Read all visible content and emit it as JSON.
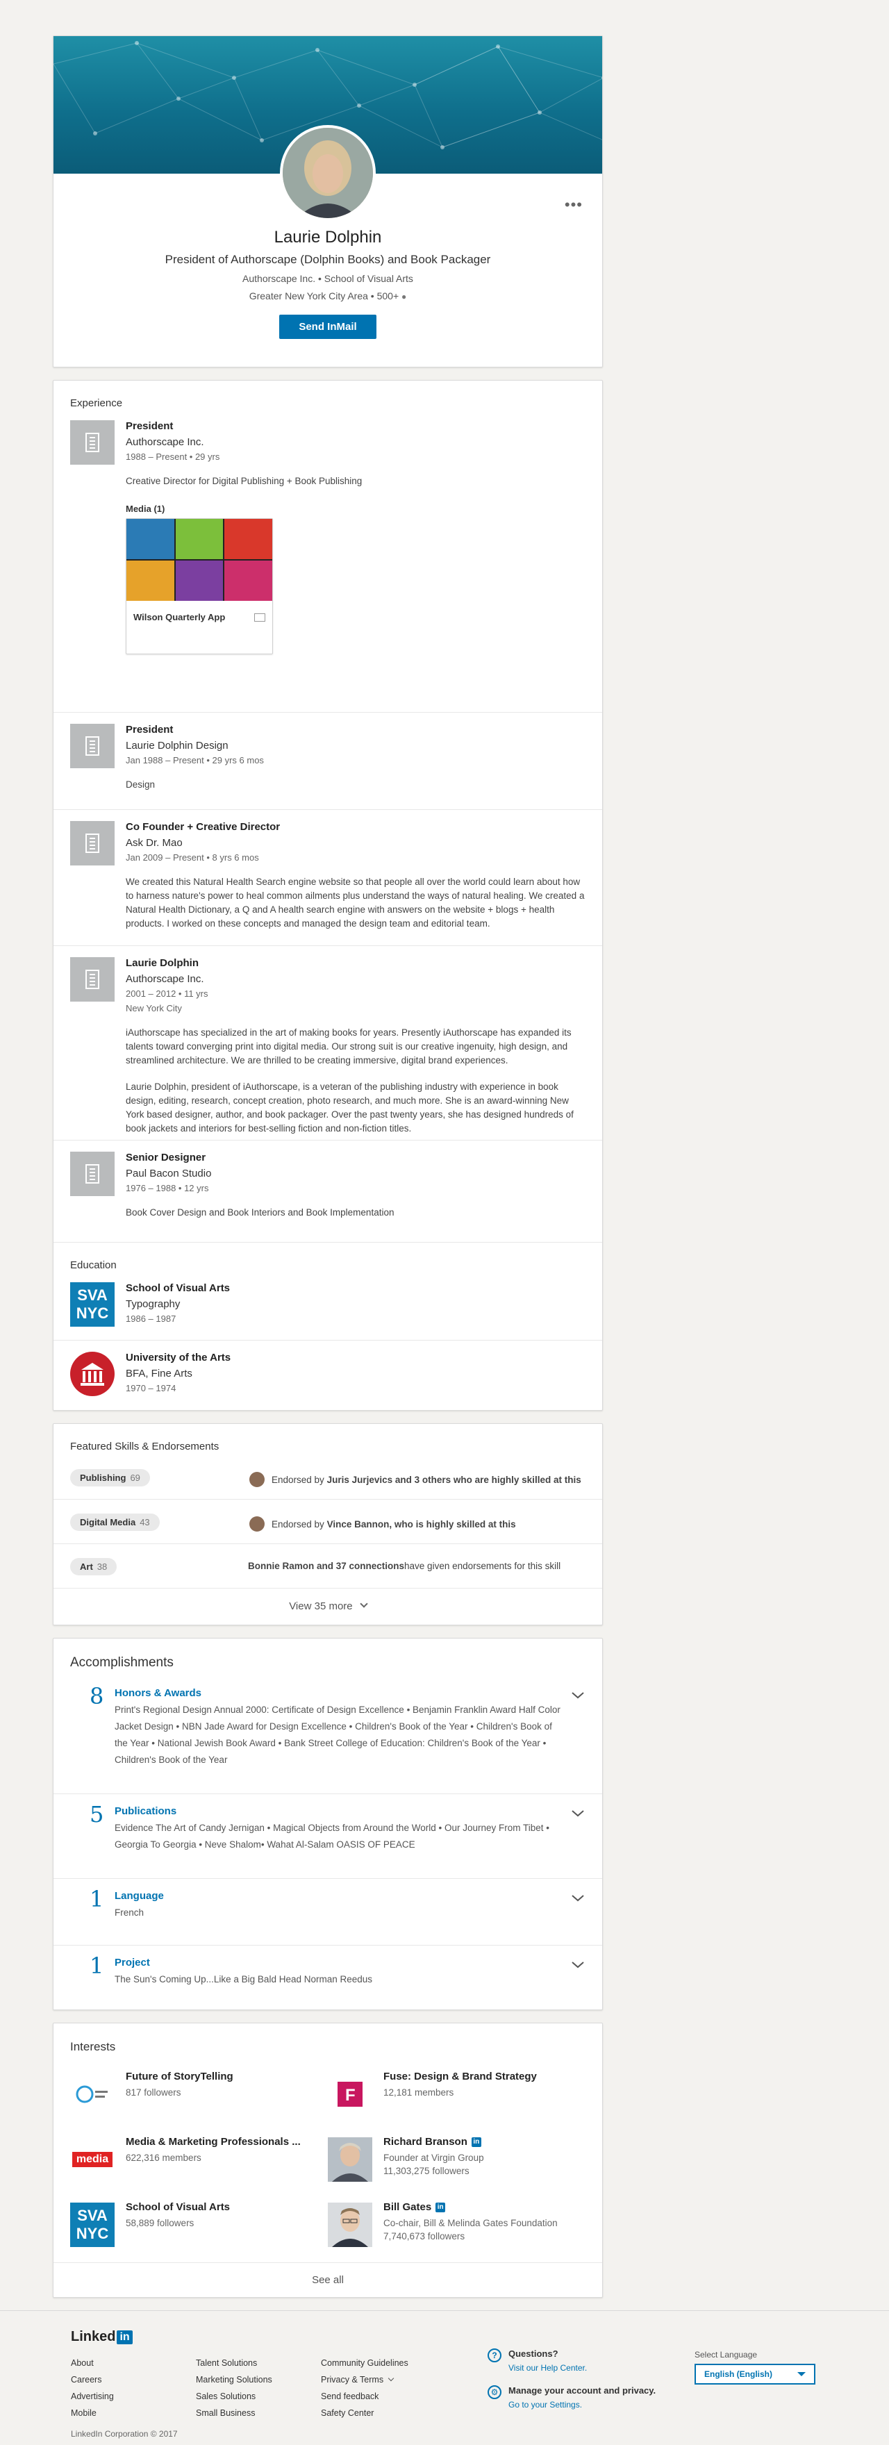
{
  "profile": {
    "name": "Laurie Dolphin",
    "headline": "President of Authorscape (Dolphin Books) and Book Packager",
    "company_line": "Authorscape Inc. • School of Visual Arts",
    "location_line": "Greater New York City Area • 500+",
    "send_inmail": "Send InMail",
    "more_menu": "•••"
  },
  "experience": {
    "title": "Experience",
    "items": [
      {
        "title": "President",
        "company": "Authorscape Inc.",
        "dates": "1988 – Present  • 29 yrs",
        "location": "",
        "desc": "Creative Director for Digital Publishing + Book Publishing",
        "media_label": "Media (1)",
        "media_caption": "Wilson Quarterly App"
      },
      {
        "title": "President",
        "company": "Laurie Dolphin Design",
        "dates": "Jan 1988 – Present  • 29 yrs 6 mos",
        "location": "",
        "desc": "Design"
      },
      {
        "title": "Co Founder + Creative Director",
        "company": "Ask Dr. Mao",
        "dates": "Jan 2009 – Present  • 8 yrs 6 mos",
        "location": "",
        "desc": "We created this Natural Health Search engine website so that people all over the world could learn about how to harness nature's power to heal common ailments plus understand the ways of natural healing. We created a Natural Health Dictionary, a Q and A health search engine with answers on the website + blogs + health products. I worked on these concepts and managed the design team and editorial team."
      },
      {
        "title": "Laurie Dolphin",
        "company": "Authorscape Inc.",
        "dates": "2001 – 2012  • 11 yrs",
        "location": "New York City",
        "desc": "iAuthorscape has specialized in the art of making books for years. Presently iAuthorscape has expanded its talents toward converging print into digital media. Our strong suit is our creative ingenuity, high design, and streamlined architecture. We are thrilled to be creating immersive, digital brand experiences.",
        "desc2": "Laurie Dolphin, president of iAuthorscape, is a veteran of the publishing industry with experience in book design, editing, research, concept creation, photo research, and much more. She is an award-winning New York based designer, author, and book packager. Over the past twenty years, she has designed hundreds of book jackets and interiors for best-selling fiction and non-fiction titles."
      },
      {
        "title": "Senior Designer",
        "company": "Paul Bacon Studio",
        "dates": "1976 – 1988  • 12 yrs",
        "location": "",
        "desc": "Book Cover Design and Book Interiors and Book Implementation"
      }
    ]
  },
  "education": {
    "title": "Education",
    "items": [
      {
        "school": "School of Visual Arts",
        "degree": "Typography",
        "dates": "1986 – 1987",
        "logo_text_1": "SVA",
        "logo_text_2": "NYC"
      },
      {
        "school": "University of the Arts",
        "degree": "BFA, Fine Arts",
        "dates": "1970 – 1974"
      }
    ]
  },
  "skills": {
    "title": "Featured Skills & Endorsements",
    "items": [
      {
        "name": "Publishing",
        "count": "69",
        "endorse_pre": "Endorsed by ",
        "endorse_bold": "Juris Jurjevics and 3 others who are highly skilled at this",
        "endorse_post": ""
      },
      {
        "name": "Digital Media",
        "count": "43",
        "endorse_pre": "Endorsed by ",
        "endorse_bold": "Vince Bannon, who is highly skilled at this",
        "endorse_post": ""
      },
      {
        "name": "Art",
        "count": "38",
        "endorse_pre": "",
        "endorse_bold": "Bonnie Ramon and 37 connections",
        "endorse_post": " have given endorsements for this skill"
      }
    ],
    "view_more": "View 35 more"
  },
  "accomplishments": {
    "title": "Accomplishments",
    "items": [
      {
        "count": "8",
        "title": "Honors & Awards",
        "body": "Print's Regional Design Annual 2000: Certificate of Design Excellence  •  Benjamin Franklin Award Half Color Jacket Design  •  NBN Jade Award for Design Excellence  •  Children's Book of the Year  •  Children's Book of the Year  •  National Jewish Book Award  •  Bank Street College of Education: Children's Book of the Year  •  Children's Book of the Year"
      },
      {
        "count": "5",
        "title": "Publications",
        "body": "Evidence The Art of Candy Jernigan  •  Magical Objects from Around the World  •  Our Journey From Tibet  •  Georgia To Georgia  •  Neve Shalom• Wahat Al-Salam OASIS OF PEACE"
      },
      {
        "count": "1",
        "title": "Language",
        "body": "French"
      },
      {
        "count": "1",
        "title": "Project",
        "body": "The Sun's Coming Up...Like a Big Bald Head Norman Reedus"
      }
    ]
  },
  "interests": {
    "title": "Interests",
    "items": [
      {
        "name": "Future of StoryTelling",
        "meta1": "817 followers",
        "meta2": "",
        "logo": "fos",
        "badge": ""
      },
      {
        "name": "Fuse: Design & Brand Strategy",
        "meta1": "12,181 members",
        "meta2": "",
        "logo": "fuse",
        "badge": ""
      },
      {
        "name": "Media & Marketing Professionals ...",
        "meta1": "622,316 members",
        "meta2": "",
        "logo": "media",
        "logo_text": "media",
        "badge": ""
      },
      {
        "name": "Richard Branson",
        "meta1": "Founder at Virgin Group",
        "meta2": "11,303,275 followers",
        "logo": "person",
        "badge": "in"
      },
      {
        "name": "School of Visual Arts",
        "meta1": "58,889 followers",
        "meta2": "",
        "logo": "sva",
        "badge": ""
      },
      {
        "name": "Bill Gates",
        "meta1": "Co-chair, Bill & Melinda Gates Foundation",
        "meta2": "7,740,673 followers",
        "logo": "person2",
        "badge": "in"
      }
    ],
    "see_all": "See all"
  },
  "footer": {
    "logo_text": "Linked",
    "logo_in": "in",
    "col1": [
      "About",
      "Careers",
      "Advertising",
      "Mobile"
    ],
    "col2": [
      "Talent Solutions",
      "Marketing Solutions",
      "Sales Solutions",
      "Small Business"
    ],
    "col3": [
      "Community Guidelines",
      "Privacy & Terms",
      "Send feedback",
      "Safety Center"
    ],
    "help_title": "Questions?",
    "help_link": "Visit our Help Center.",
    "manage_title": "Manage your account and privacy.",
    "manage_link": "Go to your Settings.",
    "lang_label": "Select Language",
    "lang_value": "English (English)",
    "copyright": "LinkedIn Corporation © 2017"
  },
  "colors": {
    "brand": "#0073b1",
    "banner": "#11708d",
    "accent_red": "#e02323"
  }
}
